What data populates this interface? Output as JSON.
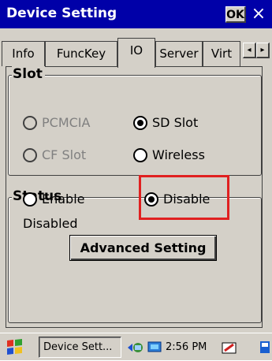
{
  "window": {
    "title": "Device Setting",
    "ok_label": "OK",
    "close_glyph": "×"
  },
  "tabs": [
    {
      "label": "Info",
      "active": false
    },
    {
      "label": "FuncKey",
      "active": false
    },
    {
      "label": "IO",
      "active": true
    },
    {
      "label": "Server",
      "active": false
    },
    {
      "label": "Virt",
      "active": false
    }
  ],
  "tab_scroll": {
    "left_glyph": "◂",
    "right_glyph": "▸"
  },
  "slot_group": {
    "legend": "Slot",
    "options": [
      {
        "label": "PCMCIA",
        "selected": false,
        "enabled": false
      },
      {
        "label": "SD Slot",
        "selected": true,
        "enabled": true
      },
      {
        "label": "CF Slot",
        "selected": false,
        "enabled": false
      },
      {
        "label": "Wireless",
        "selected": false,
        "enabled": true
      }
    ]
  },
  "status_group": {
    "legend": "Status",
    "options": [
      {
        "label": "Enable",
        "selected": false,
        "enabled": true
      },
      {
        "label": "Disable",
        "selected": true,
        "enabled": true
      }
    ],
    "status_text": "Disabled",
    "highlight_color": "#e02020"
  },
  "advanced_button": {
    "label": "Advanced Setting"
  },
  "taskbar": {
    "start_icon": "windows-flag-icon",
    "task_label": "Device Sett...",
    "time": "2:56 PM",
    "tray_icons": [
      "network-icon",
      "connection-icon",
      "keyboard-icon",
      "desktop-icon"
    ]
  },
  "colors": {
    "title_bg": "#0000a8",
    "face": "#d4d0c8"
  }
}
